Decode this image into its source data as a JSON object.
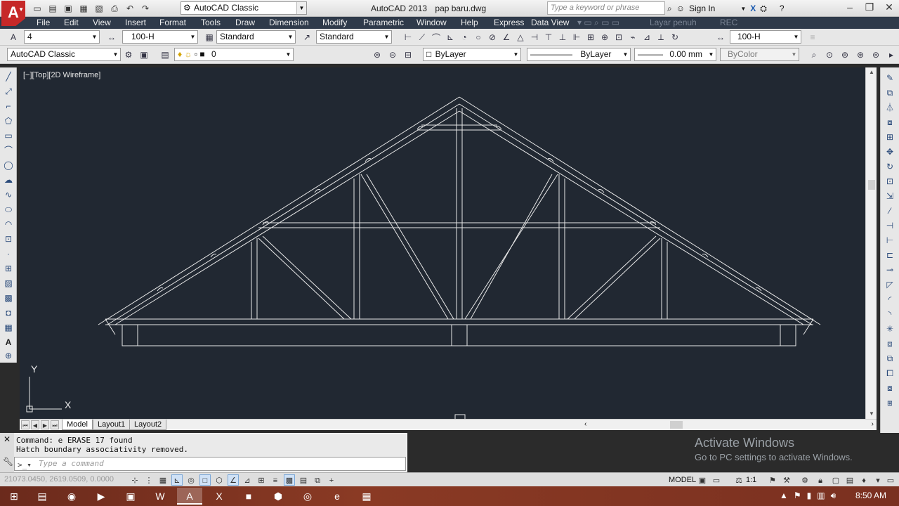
{
  "titlebar": {
    "workspace": "AutoCAD Classic",
    "app_name": "AutoCAD 2013",
    "file_name": "pap baru.dwg",
    "search_placeholder": "Type a keyword or phrase",
    "sign_in": "Sign In"
  },
  "menu": {
    "items": [
      "File",
      "Edit",
      "View",
      "Insert",
      "Format",
      "Tools",
      "Draw",
      "Dimension",
      "Modify",
      "Parametric",
      "Window",
      "Help",
      "Express",
      "Data View"
    ],
    "ghost_items": [
      "Layar penuh",
      "REC"
    ]
  },
  "toolbar1": {
    "text_style_value": "4",
    "dim_style_value": "100-H",
    "table_style_value": "Standard",
    "multileader_style_value": "Standard",
    "right_dim_value": "100-H"
  },
  "toolbar2": {
    "workspace_value": "AutoCAD Classic",
    "layer_value": "0",
    "color_value": "ByLayer",
    "linetype_value": "ByLayer",
    "lineweight_value": "0.00 mm",
    "plotstyle_value": "ByColor"
  },
  "viewport": {
    "label": "[−][Top][2D Wireframe]",
    "ucs_y": "Y",
    "ucs_x": "X"
  },
  "tabs": {
    "items": [
      "Model",
      "Layout1",
      "Layout2"
    ],
    "active": "Model"
  },
  "command": {
    "history": [
      "Command: e ERASE 17 found",
      "Hatch boundary associativity removed."
    ],
    "placeholder": "Type a command"
  },
  "watermark": {
    "line1": "Activate Windows",
    "line2": "Go to PC settings to activate Windows."
  },
  "statusbar": {
    "coords": "21073.0450, 2619.0509, 0.0000",
    "model_label": "MODEL",
    "scale": "1:1"
  },
  "taskbar": {
    "time": "8:50 AM"
  },
  "colors": {
    "drawing_bg": "#212832",
    "menubar_bg": "#2f3a4a",
    "truss_line": "#e8e8e8",
    "app_logo": "#c62828"
  }
}
